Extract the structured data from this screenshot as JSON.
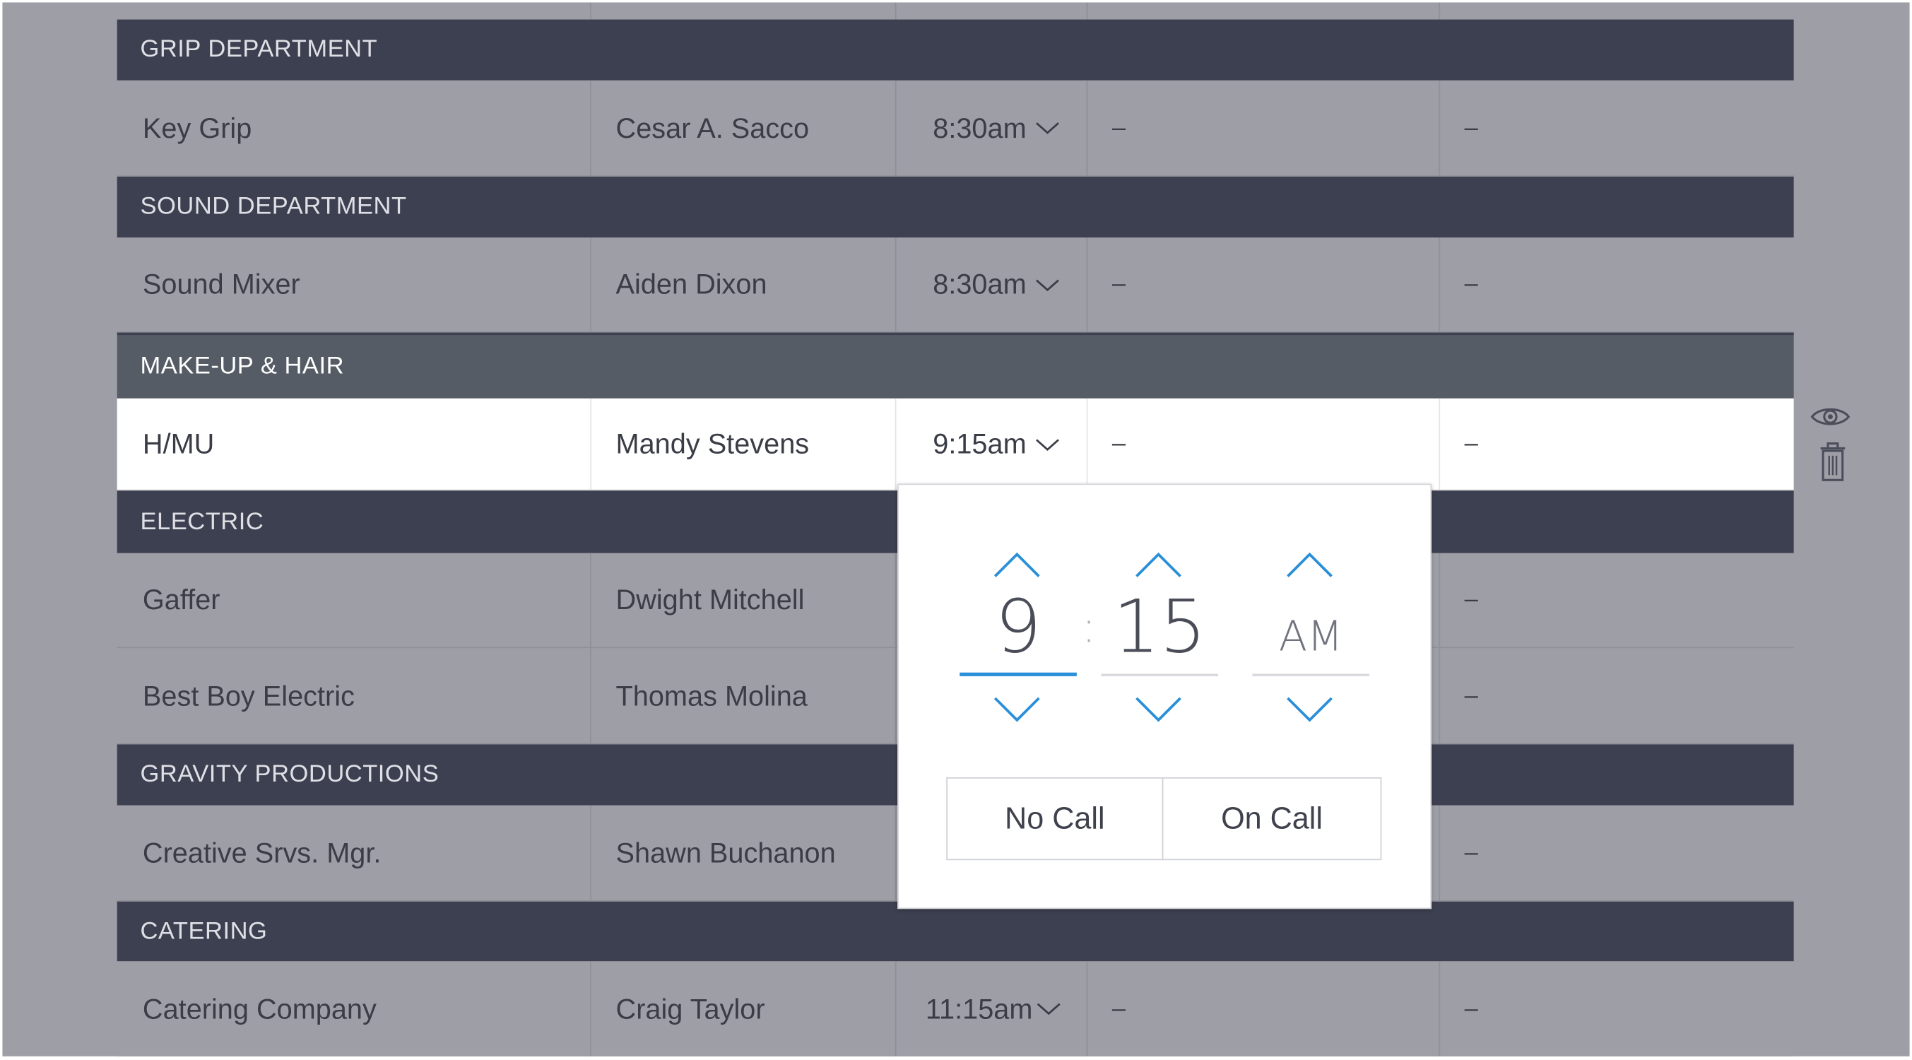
{
  "sections": [
    {
      "name": "GRIP DEPARTMENT",
      "rows": [
        {
          "role": "Key Grip",
          "person": "Cesar A. Sacco",
          "call_time": "8:30am",
          "col4": "–",
          "col5": "–"
        }
      ]
    },
    {
      "name": "SOUND DEPARTMENT",
      "rows": [
        {
          "role": "Sound Mixer",
          "person": "Aiden Dixon",
          "call_time": "8:30am",
          "col4": "–",
          "col5": "–"
        }
      ]
    },
    {
      "name": "MAKE-UP & HAIR",
      "rows": [
        {
          "role": "H/MU",
          "person": "Mandy Stevens",
          "call_time": "9:15am",
          "col4": "–",
          "col5": "–"
        }
      ]
    },
    {
      "name": "ELECTRIC",
      "rows": [
        {
          "role": "Gaffer",
          "person": "Dwight Mitchell",
          "col5": "–"
        },
        {
          "role": "Best Boy Electric",
          "person": "Thomas Molina",
          "col5": "–"
        }
      ]
    },
    {
      "name": "GRAVITY PRODUCTIONS",
      "rows": [
        {
          "role": "Creative Srvs. Mgr.",
          "person": "Shawn Buchanon",
          "col5": "–"
        }
      ]
    },
    {
      "name": "CATERING",
      "rows": [
        {
          "role": "Catering Company",
          "person": "Craig Taylor",
          "call_time": "11:15am",
          "col4": "–",
          "col5": "–"
        }
      ]
    }
  ],
  "row_actions": {
    "view_icon": "eye-icon",
    "delete_icon": "trash-icon"
  },
  "time_picker": {
    "hour": "9",
    "separator": ":",
    "minute": "15",
    "period": "AM",
    "no_call_label": "No Call",
    "on_call_label": "On Call"
  },
  "colors": {
    "section_header": "#3d4050",
    "active_section_header": "#565c66",
    "overlay_row": "#9e9ea6",
    "accent": "#2a8fd8"
  }
}
